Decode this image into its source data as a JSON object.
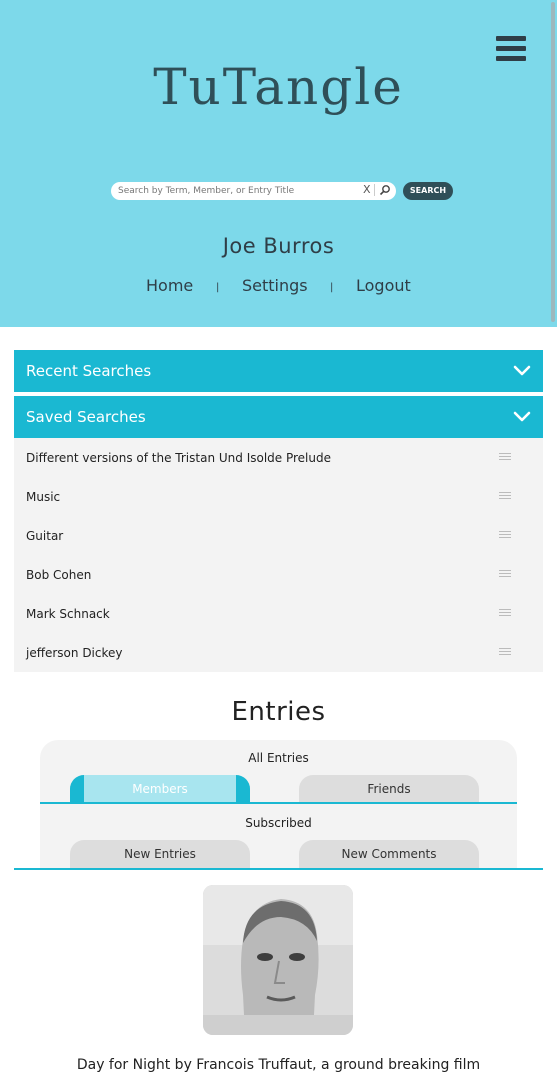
{
  "app": {
    "title": "TuTangle"
  },
  "search": {
    "placeholder": "Search by Term, Member, or Entry Title",
    "value": "",
    "clear_label": "X",
    "button_label": "SEARCH"
  },
  "user": {
    "name": "Joe Burros"
  },
  "nav": {
    "items": [
      "Home",
      "Settings",
      "Logout"
    ],
    "separator": "|"
  },
  "panels": {
    "recent": "Recent Searches",
    "saved": "Saved Searches"
  },
  "saved_searches": [
    "Different versions of the Tristan Und Isolde Prelude",
    "Music",
    "Guitar",
    "Bob Cohen",
    "Mark Schnack",
    "jefferson Dickey"
  ],
  "entries": {
    "title": "Entries",
    "group1_label": "All Entries",
    "group1_tabs": [
      "Members",
      "Friends"
    ],
    "active_tab": "Members",
    "group2_label": "Subscribed",
    "group2_tabs": [
      "New Entries",
      "New Comments"
    ]
  },
  "feed": {
    "caption": "Day for Night by Francois Truffaut, a ground breaking film"
  },
  "colors": {
    "header_bg": "#7dd9ea",
    "accent": "#1ab8d2",
    "dark": "#2f4f58"
  },
  "icons": {
    "menu": "hamburger-menu-icon",
    "search": "magnifier-icon",
    "chevron": "chevron-down-icon",
    "grip": "drag-handle-icon"
  }
}
